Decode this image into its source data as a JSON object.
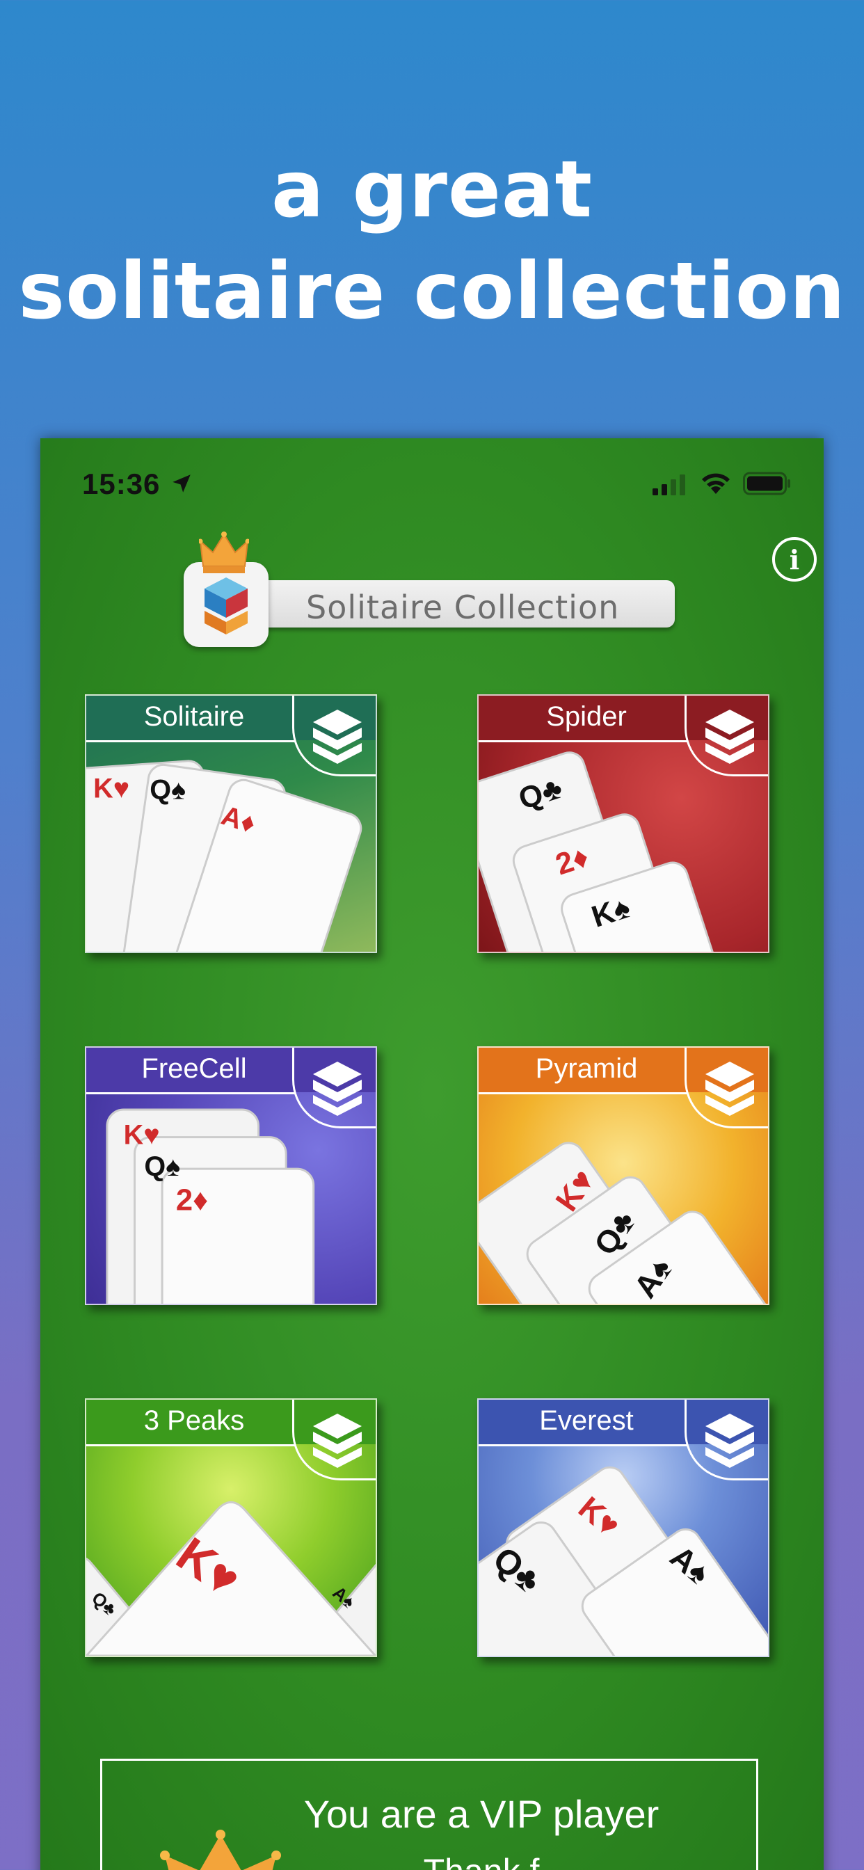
{
  "headline": {
    "line1": "a great",
    "line2": "solitaire collection"
  },
  "status_bar": {
    "time": "15:36",
    "icons": [
      "location-arrow-icon",
      "cellular-signal-icon",
      "wifi-icon",
      "battery-icon"
    ]
  },
  "header": {
    "title": "Solitaire Collection",
    "info_icon": "info-icon",
    "info_glyph": "i"
  },
  "games": [
    {
      "label": "Solitaire",
      "color": "#1f6e55"
    },
    {
      "label": "Spider",
      "color": "#8c1c22"
    },
    {
      "label": "FreeCell",
      "color": "#4c3aa8"
    },
    {
      "label": "Pyramid",
      "color": "#e3731b"
    },
    {
      "label": "3 Peaks",
      "color": "#3b9a1c"
    },
    {
      "label": "Everest",
      "color": "#3c54b0"
    }
  ],
  "vip": {
    "title": "You are a VIP player",
    "subtitle_partial": "Thank f"
  },
  "colors": {
    "felt": "#2f8a22",
    "background_top": "#2e88cc",
    "background_bottom": "#7d6fc6"
  }
}
